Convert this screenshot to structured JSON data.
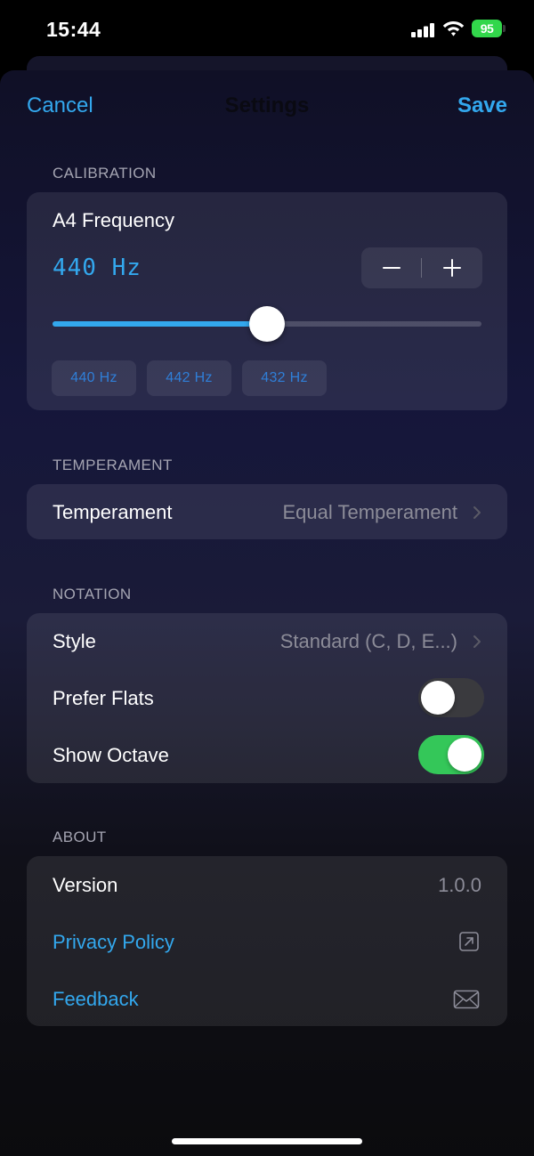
{
  "status_bar": {
    "time": "15:44",
    "battery": "95"
  },
  "nav": {
    "cancel": "Cancel",
    "title": "Settings",
    "save": "Save"
  },
  "calibration": {
    "header": "CALIBRATION",
    "label": "A4 Frequency",
    "value": "440 Hz",
    "slider_fraction": 0.5,
    "presets": [
      "440 Hz",
      "442 Hz",
      "432 Hz"
    ]
  },
  "temperament": {
    "header": "TEMPERAMENT",
    "label": "Temperament",
    "value": "Equal Temperament"
  },
  "notation": {
    "header": "NOTATION",
    "style_label": "Style",
    "style_value": "Standard (C, D, E...)",
    "prefer_flats_label": "Prefer Flats",
    "prefer_flats_on": false,
    "show_octave_label": "Show Octave",
    "show_octave_on": true
  },
  "about": {
    "header": "ABOUT",
    "version_label": "Version",
    "version_value": "1.0.0",
    "privacy_label": "Privacy Policy",
    "feedback_label": "Feedback"
  },
  "colors": {
    "accent": "#33a8ee",
    "toggle_on": "#34c759",
    "toggle_off": "#3a3a3e",
    "preset_text": "#2f7fd8"
  },
  "icons": {
    "signal": "cellular-signal-icon",
    "wifi": "wifi-icon",
    "privacy": "external-link-icon",
    "feedback": "envelope-icon"
  }
}
